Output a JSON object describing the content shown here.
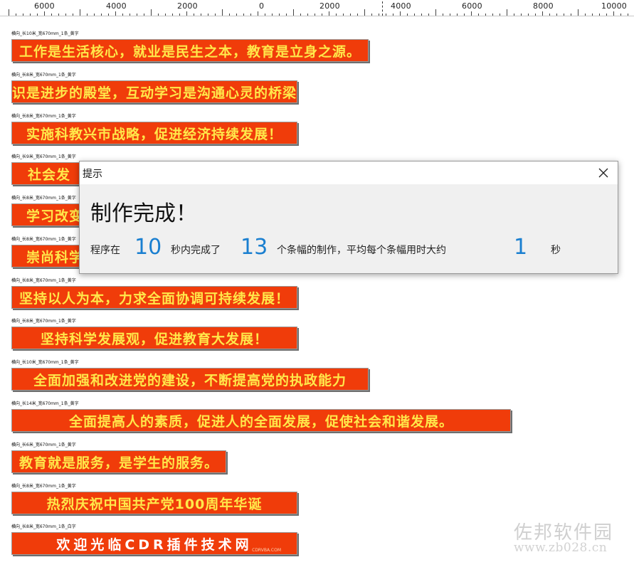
{
  "ruler": {
    "labels": [
      "6000",
      "4000",
      "2000",
      "0",
      "2000",
      "4000",
      "6000",
      "8000",
      "10000"
    ]
  },
  "banners": [
    {
      "label": "横向_长10米_宽670mm_1条_黄字",
      "text": "工作是生活核心，就业是民生之本，教育是立身之源。"
    },
    {
      "label": "横向_长8米_宽670mm_1条_黄字",
      "text": "知识是进步的殿堂，互动学习是沟通心灵的桥梁。"
    },
    {
      "label": "横向_长8米_宽670mm_1条_黄字",
      "text": "实施科教兴市战略，促进经济持续发展！"
    },
    {
      "label": "横向_长9米_宽670mm_1条_黄字",
      "text": "社会发"
    },
    {
      "label": "横向_长8米_宽670mm_1条_黄字",
      "text": "学习改变"
    },
    {
      "label": "横向_长8米_宽670mm_1条_黄字",
      "text": "崇尚科学"
    },
    {
      "label": "横向_长8米_宽670mm_1条_黄字",
      "text": "坚持以人为本，力求全面协调可持续发展！"
    },
    {
      "label": "横向_长8米_宽670mm_1条_黄字",
      "text": "坚持科学发展观，促进教育大发展！"
    },
    {
      "label": "横向_长10米_宽670mm_1条_黄字",
      "text": "全面加强和改进党的建设，不断提高党的执政能力"
    },
    {
      "label": "横向_长14米_宽670mm_1条_黄字",
      "text": "全面提高人的素质，促进人的全面发展，促使社会和谐发展。"
    },
    {
      "label": "横向_长6米_宽670mm_1条_黄字",
      "text": "教育就是服务，是学生的服务。"
    },
    {
      "label": "横向_长8米_宽670mm_1条_黄字",
      "text": "热烈庆祝中国共产党100周年华诞"
    },
    {
      "label": "横向_长8米_宽670mm_1条_白字",
      "text": "欢迎光临CDR插件技术网",
      "sub": "CDRVBA.COM"
    }
  ],
  "dialog": {
    "title": "提示",
    "heading": "制作完成！",
    "msg_prefix": "程序在",
    "seconds_total": "10",
    "msg_mid": "秒内完成了",
    "banner_count": "13",
    "msg_mid2": "个条幅的制作，平均每个条幅用时大约",
    "avg_seconds": "1",
    "msg_suffix": "秒",
    "close_icon": "close-icon",
    "accent_color": "#1a7fd0"
  },
  "watermark": {
    "name": "佐邦软件园",
    "url": "www.zb028.cn"
  },
  "colors": {
    "banner_bg": "#f03c0a",
    "banner_text": "#ffe84a",
    "banner_text_white": "#ffffff"
  }
}
